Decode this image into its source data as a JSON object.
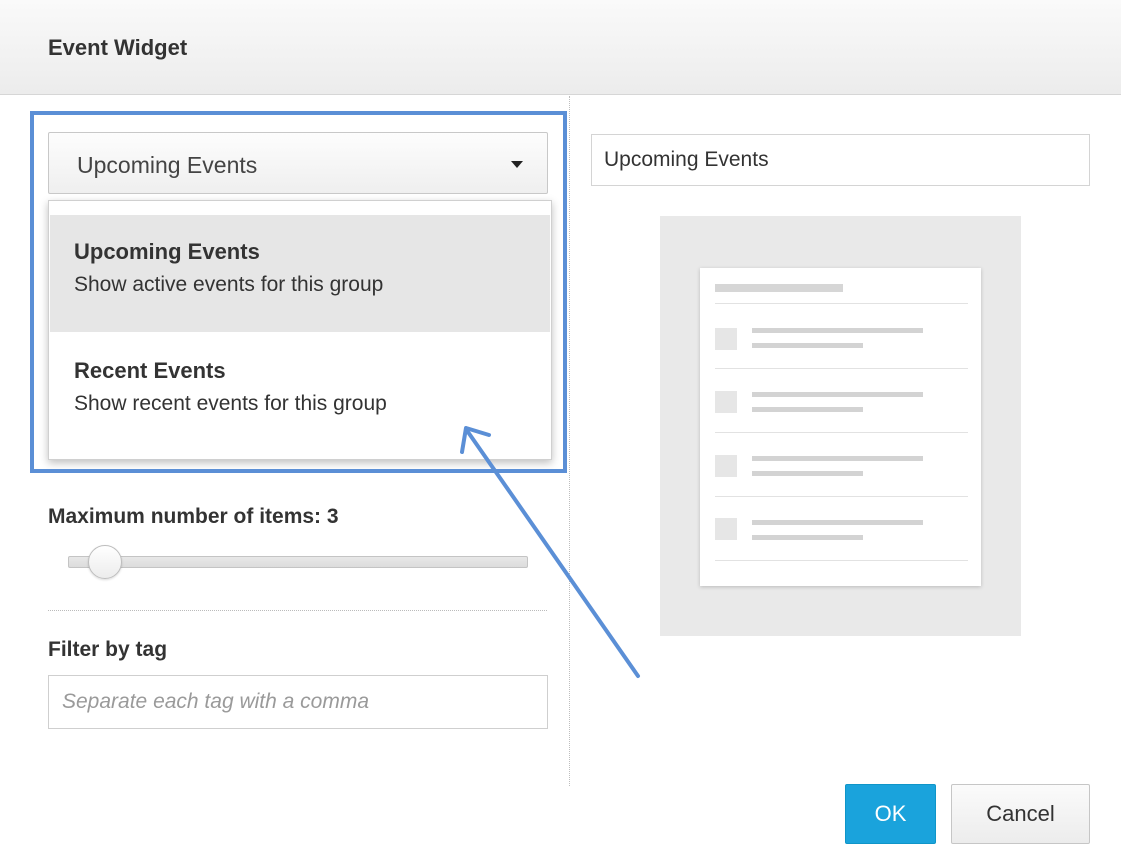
{
  "dialog": {
    "title": "Event Widget"
  },
  "select": {
    "value": "Upcoming Events",
    "options": [
      {
        "title": "Upcoming Events",
        "desc": "Show active events for this group",
        "selected": true
      },
      {
        "title": "Recent Events",
        "desc": "Show recent events for this group",
        "selected": false
      }
    ]
  },
  "max_items": {
    "label": "Maximum number of items: 3",
    "value": 3
  },
  "filter": {
    "label": "Filter by tag",
    "placeholder": "Separate each tag with a comma",
    "value": ""
  },
  "widget_title": {
    "value": "Upcoming Events"
  },
  "buttons": {
    "ok": "OK",
    "cancel": "Cancel"
  },
  "colors": {
    "accent": "#1aa3dc",
    "annotation": "#5b8fd6",
    "menu_selected": "#e6e6e6"
  },
  "icons": {
    "caret": "caret-down-icon",
    "annotation_arrow": "annotation-arrow-icon"
  }
}
